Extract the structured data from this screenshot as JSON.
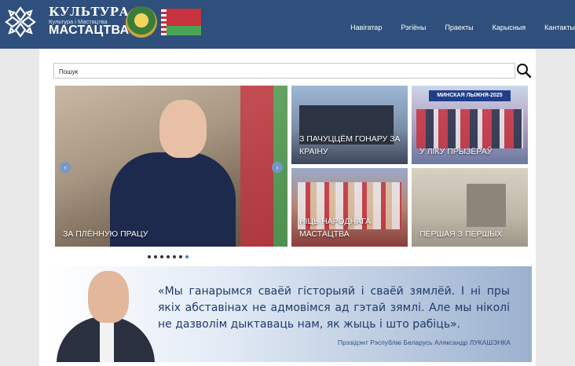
{
  "header": {
    "logo_line1": "КУЛЬТУРА",
    "logo_line2": "Культура і Мастацтва",
    "logo_line3": "МАСТАЦТВА",
    "nav": [
      "Навігатар",
      "Рэгіёны",
      "Праекты",
      "Карысныя",
      "Кантакты"
    ]
  },
  "search": {
    "placeholder": "Пошук"
  },
  "slider": {
    "main_caption": "ЗА ПЛЁННУЮ ПРАЦУ",
    "dots": 7,
    "active_dot": 7
  },
  "tiles": [
    {
      "caption": "З ПАЧУЦЦЁМ ГОНАРУ ЗА КРАІНУ"
    },
    {
      "caption": "У ЛІКУ ПРЫЗЁРАЎ",
      "banner": "МИНСКАЯ ЛЫЖНЯ-2025"
    },
    {
      "caption": "НІЦЬ НАРОДНАГА МАСТАЦТВА"
    },
    {
      "caption": "ПЕРШАЯ З ПЕРШЫХ"
    }
  ],
  "quote": {
    "text": "«Мы ганарымся сваёй гісторыяй і сваёй зямлёй. І ні пры якіх абставінах не адмовімся ад гэтай зямлі. Але мы ніколі не дазволім дыктаваць нам, як жыць і што рабіць».",
    "attribution": "Прэзідэнт Рэспублікі Беларусь Аляксандр ЛУКАШЭНКА"
  }
}
